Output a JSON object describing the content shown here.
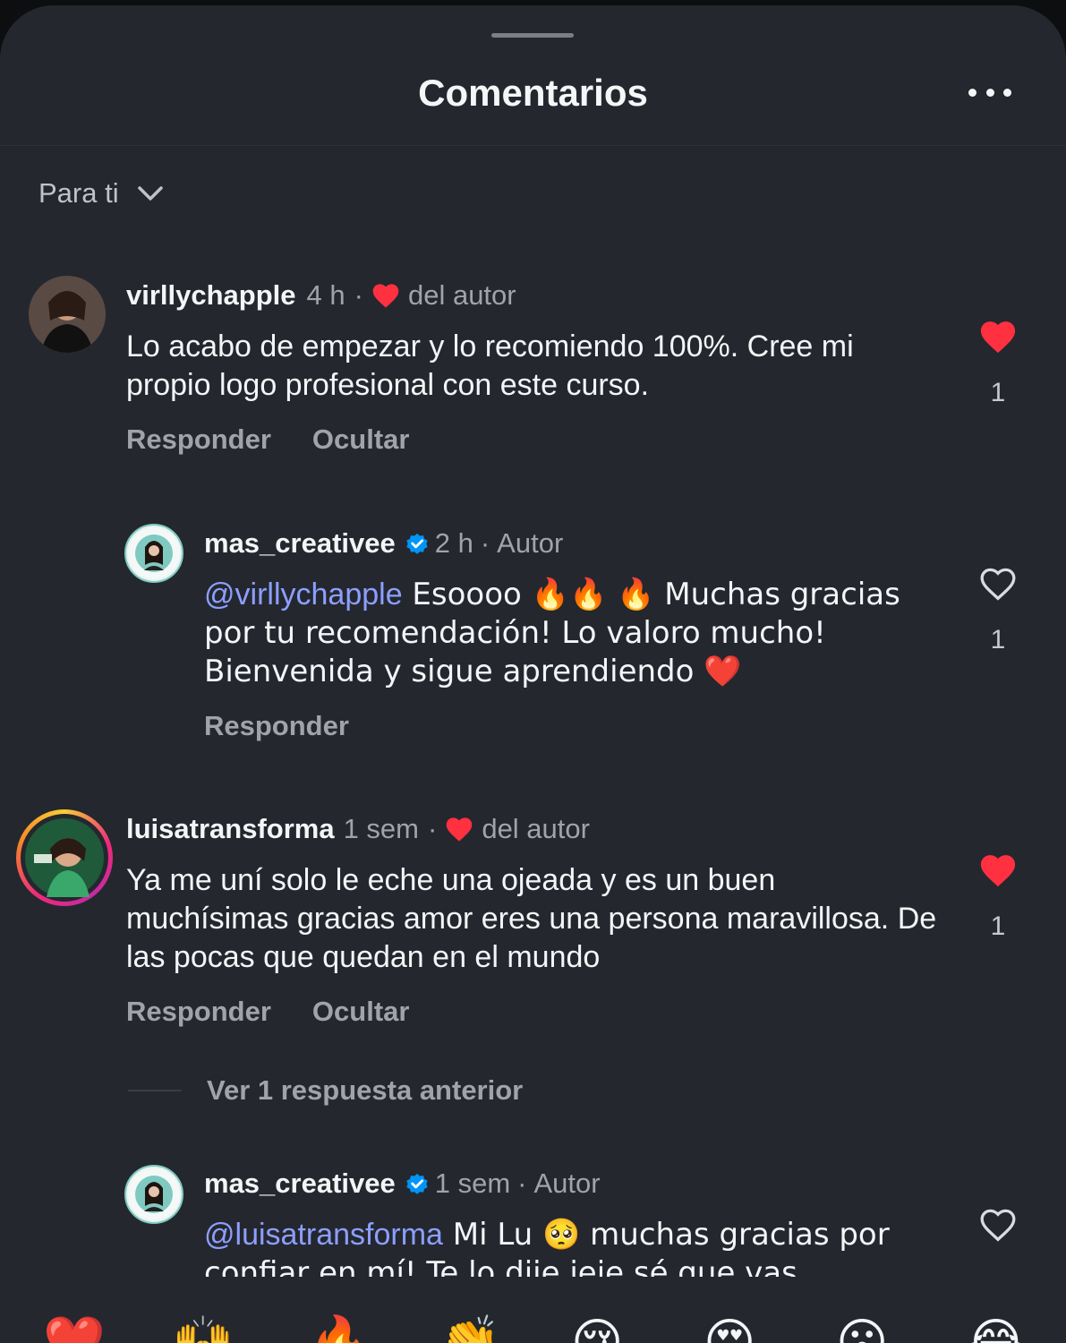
{
  "header": {
    "title": "Comentarios",
    "more_icon": "more-horizontal-icon"
  },
  "filter": {
    "label": "Para ti",
    "icon": "chevron-down-icon"
  },
  "comments": [
    {
      "username": "virllychapple",
      "time": "4 h",
      "sep": "·",
      "author_like": "del autor",
      "text": "Lo acabo de empezar y lo recomiendo 100%. Cree mi propio logo profesional con este curso.",
      "reply": "Responder",
      "hide": "Ocultar",
      "likes": "1",
      "liked": true
    },
    {
      "username": "mas_creativee",
      "time": "2 h",
      "sep": "·",
      "badge": "Autor",
      "mention": "@virllychapple",
      "text": " Esoooo 🔥🔥 🔥 Muchas gracias por tu recomendación! Lo valoro mucho!  Bienvenida y sigue aprendiendo ❤️",
      "reply": "Responder",
      "likes": "1",
      "liked": false
    },
    {
      "username": "luisatransforma",
      "time": "1 sem",
      "sep": "·",
      "author_like": "del autor",
      "text": "Ya me uní solo le eche una ojeada y es un buen muchísimas gracias amor eres una persona maravillosa. De las pocas que quedan en el mundo",
      "reply": "Responder",
      "hide": "Ocultar",
      "likes": "1",
      "liked": true
    },
    {
      "username": "mas_creativee",
      "time": "1 sem",
      "sep": "·",
      "badge": "Autor",
      "mention": "@luisatransforma",
      "text": " Mi Lu 🥺 muchas gracias por confiar en mí! Te lo dije jeje sé que vas",
      "liked": false
    }
  ],
  "view_more": "Ver 1 respuesta anterior",
  "emoji_bar": [
    "❤️",
    "🙌",
    "🔥",
    "👏",
    "😢",
    "😍",
    "😮",
    "😂"
  ],
  "colors": {
    "like_red": "#ff3040",
    "mention": "#8c9fff",
    "verified": "#0095f6"
  }
}
